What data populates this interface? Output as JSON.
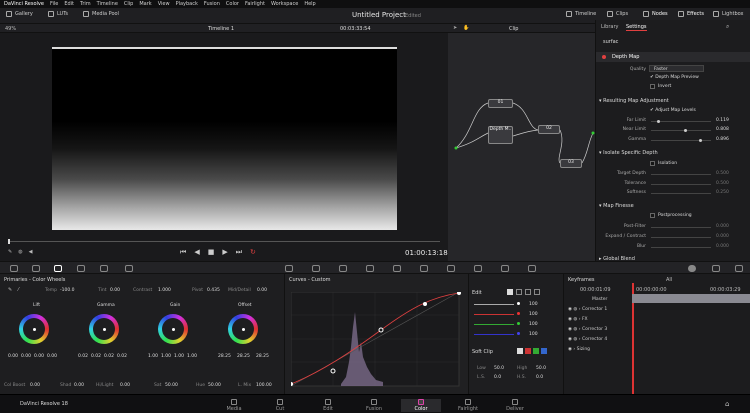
{
  "menu": [
    "DaVinci Resolve",
    "File",
    "Edit",
    "Trim",
    "Timeline",
    "Clip",
    "Mark",
    "View",
    "Playback",
    "Fusion",
    "Color",
    "Fairlight",
    "Workspace",
    "Help"
  ],
  "toolbar": {
    "gallery": "Gallery",
    "luts": "LUTs",
    "media_pool": "Media Pool",
    "project_title": "Untitled Project",
    "edited": "Edited",
    "timeline": "Timeline",
    "clips": "Clips",
    "nodes": "Nodes",
    "effects": "Effects",
    "lightbox": "Lightbox"
  },
  "viewer": {
    "zoom": "49%",
    "timeline_name": "Timeline 1",
    "timecode_top": "00:03:33:54",
    "clip_mode": "Clip",
    "timecode": "01:00:13:18"
  },
  "nodes": {
    "n1": "01",
    "n2": "Depth M..",
    "n3": "02",
    "n4": "03"
  },
  "inspector": {
    "tab_library": "Library",
    "tab_settings": "Settings",
    "search": "surfac",
    "depth_map": "Depth Map",
    "quality_label": "Quality",
    "quality_value": "Faster",
    "depth_preview": "Depth Map Preview",
    "invert": "Invert",
    "resulting": "Resulting Map Adjustment",
    "adjust_levels": "Adjust Map Levels",
    "far_label": "Far Limit",
    "far_value": "0.119",
    "near_label": "Near Limit",
    "near_value": "0.808",
    "gamma_label": "Gamma",
    "gamma_value": "0.896",
    "isolate": "Isolate Specific Depth",
    "isolation": "Isolation",
    "target_label": "Target Depth",
    "target_value": "0.500",
    "tolerance_label": "Tolerance",
    "tolerance_value": "0.500",
    "softness_label": "Softness",
    "softness_value": "0.250",
    "finesse": "Map Finesse",
    "postprocessing": "Postprocessing",
    "postfilter_label": "Post-Filter",
    "postfilter_value": "0.000",
    "expand_label": "Expand / Contract",
    "expand_value": "0.000",
    "blur_label": "Blur",
    "blur_value": "0.000",
    "global_blend": "Global Blend"
  },
  "wheels": {
    "title": "Primaries - Color Wheels",
    "temp_label": "Temp",
    "temp_value": "-100.0",
    "tint_label": "Tint",
    "tint_value": "0.00",
    "contrast_label": "Contrast",
    "contrast_value": "1.000",
    "pivot_label": "Pivot",
    "pivot_value": "0.435",
    "middetail_label": "Mid/Detail",
    "middetail_value": "0.00",
    "lift": "Lift",
    "gamma": "Gamma",
    "gain": "Gain",
    "offset": "Offset",
    "lift_vals": [
      "0.00",
      "0.00",
      "0.00",
      "0.00"
    ],
    "gamma_vals": [
      "0.02",
      "0.02",
      "0.02",
      "0.02"
    ],
    "gain_vals": [
      "1.00",
      "1.00",
      "1.00",
      "1.00"
    ],
    "offset_vals": [
      "28.25",
      "28.25",
      "28.25"
    ],
    "colboost_label": "Col Boost",
    "colboost_value": "0.00",
    "shad_label": "Shad",
    "shad_value": "0.00",
    "hilight_label": "Hi/Light",
    "hilight_value": "0.00",
    "sat_label": "Sat",
    "sat_value": "50.00",
    "hue_label": "Hue",
    "hue_value": "50.00",
    "lmix_label": "L. Mix",
    "lmix_value": "100.00"
  },
  "curves": {
    "title": "Curves - Custom"
  },
  "edits": {
    "title": "Edit",
    "values": [
      "100",
      "100",
      "100",
      "100"
    ],
    "softclip": "Soft Clip",
    "low_label": "Low",
    "low_value": "50.0",
    "high_label": "High",
    "high_value": "50.0",
    "ls_label": "L.S.",
    "ls_value": "0.0",
    "hs_label": "H.S.",
    "hs_value": "0.0"
  },
  "keyframes": {
    "title": "Keyframes",
    "all": "All",
    "tc1": "00:00:01:09",
    "tc2": "00:00:00:00",
    "tc3": "00:00:03:29",
    "rows": [
      "Master",
      "Corrector 1",
      "FX",
      "Corrector 3",
      "Corrector 4",
      "Sizing"
    ]
  },
  "pages": {
    "app": "DaVinci Resolve 18",
    "items": [
      "Media",
      "Cut",
      "Edit",
      "Fusion",
      "Color",
      "Fairlight",
      "Deliver"
    ]
  }
}
